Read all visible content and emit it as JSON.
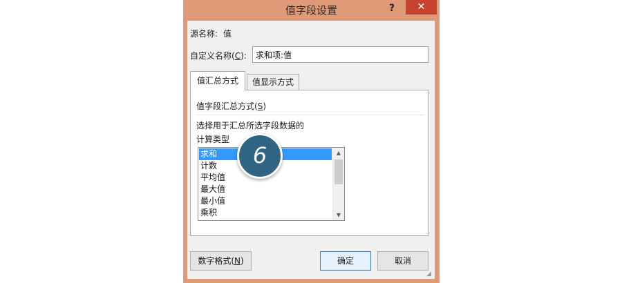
{
  "window": {
    "title": "值字段设置",
    "help_label": "?",
    "close_label": "✕"
  },
  "source": {
    "label": "源名称:",
    "value": "值"
  },
  "custom_name": {
    "label_pre": "自定义名称(",
    "label_key": "C",
    "label_post": "):",
    "value": "求和项:值"
  },
  "tabs": [
    {
      "label": "值汇总方式",
      "active": true
    },
    {
      "label": "值显示方式",
      "active": false
    }
  ],
  "panel": {
    "section_pre": "值字段汇总方式(",
    "section_key": "S",
    "section_post": ")",
    "description": "选择用于汇总所选字段数据的",
    "calc_type_label": "计算类型"
  },
  "list": {
    "items": [
      "求和",
      "计数",
      "平均值",
      "最大值",
      "最小值",
      "乘积"
    ],
    "selected_index": 0,
    "scroll_up": "▲",
    "scroll_down": "▼"
  },
  "buttons": {
    "number_format_pre": "数字格式(",
    "number_format_key": "N",
    "number_format_post": ")",
    "ok": "确定",
    "cancel": "取消"
  },
  "badge": {
    "text": "6"
  },
  "colors": {
    "window_frame": "#e19a78",
    "close_button": "#c7432f",
    "selection": "#3399ff",
    "badge": "#2f6582"
  },
  "grip": "◢"
}
